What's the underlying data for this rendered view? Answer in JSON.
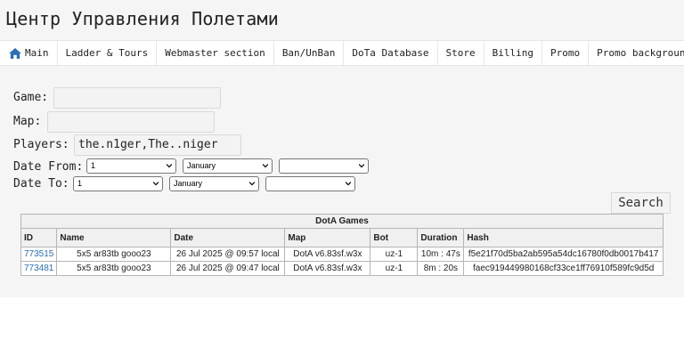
{
  "header": {
    "title": "Центр Управления Полетами"
  },
  "nav": {
    "items": [
      {
        "label": "Main",
        "icon": "home-icon"
      },
      {
        "label": "Ladder & Tours"
      },
      {
        "label": "Webmaster section"
      },
      {
        "label": "Ban/UnBan"
      },
      {
        "label": "DoTa Database"
      },
      {
        "label": "Store"
      },
      {
        "label": "Billing"
      },
      {
        "label": "Promo"
      },
      {
        "label": "Promo background"
      }
    ]
  },
  "form": {
    "game_label": "Game:",
    "game_value": "",
    "map_label": "Map:",
    "map_value": "",
    "players_label": "Players:",
    "players_value": "the.n1ger,The..niger",
    "date_from_label": "Date From:",
    "date_from": {
      "day": "1",
      "month": "January",
      "year": ""
    },
    "date_to_label": "Date To:",
    "date_to": {
      "day": "1",
      "month": "January",
      "year": ""
    },
    "search_label": "Search"
  },
  "table": {
    "caption": "DotA Games",
    "columns": [
      "ID",
      "Name",
      "Date",
      "Map",
      "Bot",
      "Duration",
      "Hash"
    ],
    "rows": [
      {
        "id": "773515",
        "name": "5x5 ar83tb gooo23",
        "date": "26 Jul 2025 @ 09:57 local",
        "map": "DotA v6.83sf.w3x",
        "bot": "uz-1",
        "duration": "10m : 47s",
        "hash": "f5e21f70d5ba2ab595a54dc16780f0db0017b417"
      },
      {
        "id": "773481",
        "name": "5x5 ar83tb gooo23",
        "date": "26 Jul 2025 @ 09:47 local",
        "map": "DotA v6.83sf.w3x",
        "bot": "uz-1",
        "duration": "8m : 20s",
        "hash": "faec919449980168cf33ce1ff76910f589fc9d5d"
      }
    ]
  },
  "colors": {
    "accent": "#2a6fb5",
    "link": "#2a6fb5"
  }
}
